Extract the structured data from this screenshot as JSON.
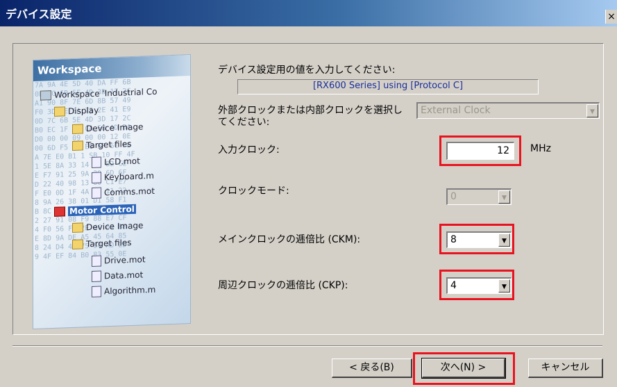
{
  "window": {
    "title": "デバイス設定",
    "close_label": "×"
  },
  "illustration": {
    "header": "Workspace",
    "hex_lines": [
      "7A 9A 4E 5D 40 DA FF 6B",
      "0D 7C 6B 5E 4D 3D 17 2C",
      "A1 90 8F 7E 6D 8B 57 49",
      "F0 3D 4E 6A 73 2E 41 E9",
      "0D 7C 6B 5E 4D 3D 17 2C",
      "B0 EC 1F 12 CA 5B AD BA",
      "D0 00 00 09 00 00 12 0E",
      "00 6D F5 DE E0 EF 6C FE",
      "A 7E E0 B1 1 SB 10 FF 4F",
      "1 5E 8A 33 14 EE B2 CE",
      "E F7 91 25 9A 29 6D 6F",
      "D 22 40 98 13 80 C1 E7",
      "F E0 0D 1F 4A 3B 11 22",
      "8 9A 26 38 01 D1 58 F1",
      "B 8C 1A 2C 1F 5D 2E 27",
      "2 27 91 08 F9 88 E7 CF",
      "4 F0 56 FD 2E 4C 67 88",
      "E 8D 9A DE A5 45 64 85",
      "8 24 D4 4D 75 54 AD 2D",
      "9 4F EF 84 B0 83 55 0E"
    ],
    "tree": [
      {
        "label": "Workspace 'Industrial Co",
        "icon": "ws"
      },
      {
        "label": "Display",
        "icon": "folder"
      },
      {
        "label": "Device Image",
        "icon": "folder"
      },
      {
        "label": "Target files",
        "icon": "folder"
      },
      {
        "label": "LCD.mot",
        "icon": "file"
      },
      {
        "label": "Keyboard.m",
        "icon": "file"
      },
      {
        "label": "Comms.mot",
        "icon": "file"
      },
      {
        "label": "Motor Control",
        "icon": "red"
      },
      {
        "label": "Device Image",
        "icon": "folder"
      },
      {
        "label": "Target files",
        "icon": "folder"
      },
      {
        "label": "Drive.mot",
        "icon": "file"
      },
      {
        "label": "Data.mot",
        "icon": "file"
      },
      {
        "label": "Algorithm.m",
        "icon": "file"
      }
    ]
  },
  "form": {
    "prompt": "デバイス設定用の値を入力してください:",
    "info": "[RX600 Series]  using  [Protocol C]",
    "clock_select_label_1": "外部クロックまたは内部クロックを選択し",
    "clock_select_label_2": "てください:",
    "clock_select_value": "External Clock",
    "input_clock_label": "入力クロック:",
    "input_clock_value": "12",
    "input_clock_unit": "MHz",
    "clock_mode_label": "クロックモード:",
    "clock_mode_value": "0",
    "ckm_label": "メインクロックの逓倍比 (CKM):",
    "ckm_value": "8",
    "ckp_label": "周辺クロックの逓倍比 (CKP):",
    "ckp_value": "4"
  },
  "buttons": {
    "back": "< 戻る(B)",
    "next": "次へ(N) >",
    "cancel": "キャンセル"
  },
  "colors": {
    "highlight": "#e8131f",
    "info_text": "#1a2e9a",
    "titlebar": "#0a246a"
  }
}
